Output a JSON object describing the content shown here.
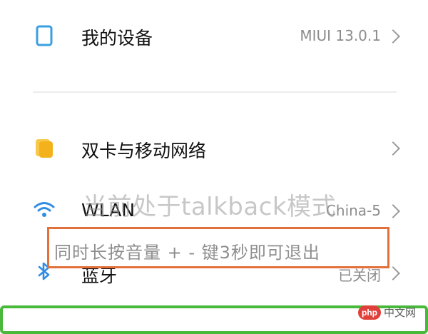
{
  "settings": {
    "my_device": {
      "label": "我的设备",
      "value": "MIUI 13.0.1"
    },
    "dual_sim": {
      "label": "双卡与移动网络"
    },
    "wlan": {
      "label": "WLAN",
      "value": "China-5"
    },
    "bluetooth": {
      "label": "蓝牙",
      "value": "已关闭"
    }
  },
  "talkback_overlay": {
    "message": "当前处于talkback模式",
    "hint": "同时长按音量 + - 键3秒即可退出"
  },
  "watermark": {
    "logo": "php",
    "text": "中文网"
  },
  "colors": {
    "device_icon": "#3a9fe0",
    "sim_icon": "#f3b21c",
    "wifi_icon": "#2f8de4",
    "bluetooth_icon": "#2f8de4",
    "highlight_box": "#e2703a",
    "focus_frame": "#49b93c"
  },
  "icons": [
    "device-icon",
    "sim-card-icon",
    "wifi-icon",
    "bluetooth-icon",
    "chevron-right-icon"
  ]
}
